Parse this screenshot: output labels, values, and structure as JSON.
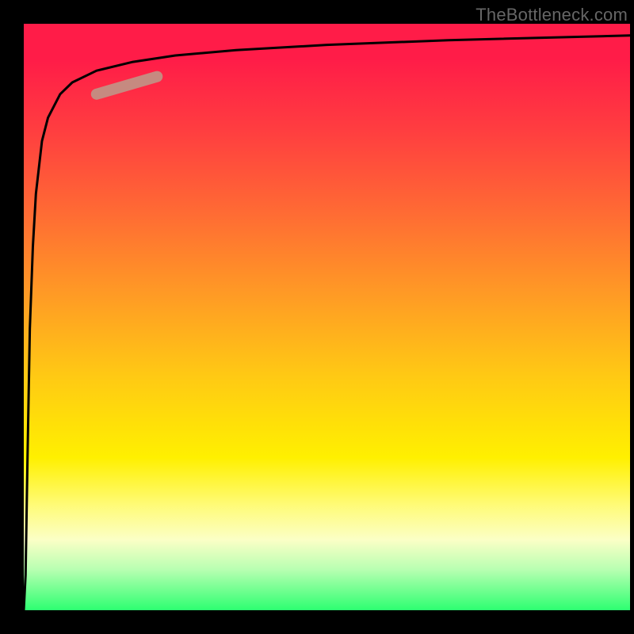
{
  "watermark": "TheBottleneck.com",
  "chart_data": {
    "type": "line",
    "title": "",
    "xlabel": "",
    "ylabel": "",
    "xlim": [
      0,
      100
    ],
    "ylim": [
      0,
      100
    ],
    "x": [
      0,
      0.3,
      0.6,
      1,
      1.5,
      2,
      3,
      4,
      6,
      8,
      12,
      18,
      25,
      35,
      50,
      70,
      100
    ],
    "values": [
      0,
      6,
      25,
      48,
      62,
      71,
      80,
      84,
      88,
      90,
      92,
      93.5,
      94.6,
      95.5,
      96.4,
      97.2,
      98.0
    ],
    "highlight_segment": {
      "x_start": 12,
      "x_end": 22,
      "y_start": 88,
      "y_end": 91
    },
    "gradient_stops": [
      {
        "pos": 0,
        "color": "#ff1c48"
      },
      {
        "pos": 6,
        "color": "#ff1c48"
      },
      {
        "pos": 18,
        "color": "#ff3d40"
      },
      {
        "pos": 32,
        "color": "#ff6a34"
      },
      {
        "pos": 46,
        "color": "#ff9a25"
      },
      {
        "pos": 60,
        "color": "#ffc914"
      },
      {
        "pos": 74,
        "color": "#fff000"
      },
      {
        "pos": 82,
        "color": "#fffb77"
      },
      {
        "pos": 88,
        "color": "#fbffc6"
      },
      {
        "pos": 93,
        "color": "#b9ffb2"
      },
      {
        "pos": 100,
        "color": "#2dff71"
      }
    ]
  }
}
